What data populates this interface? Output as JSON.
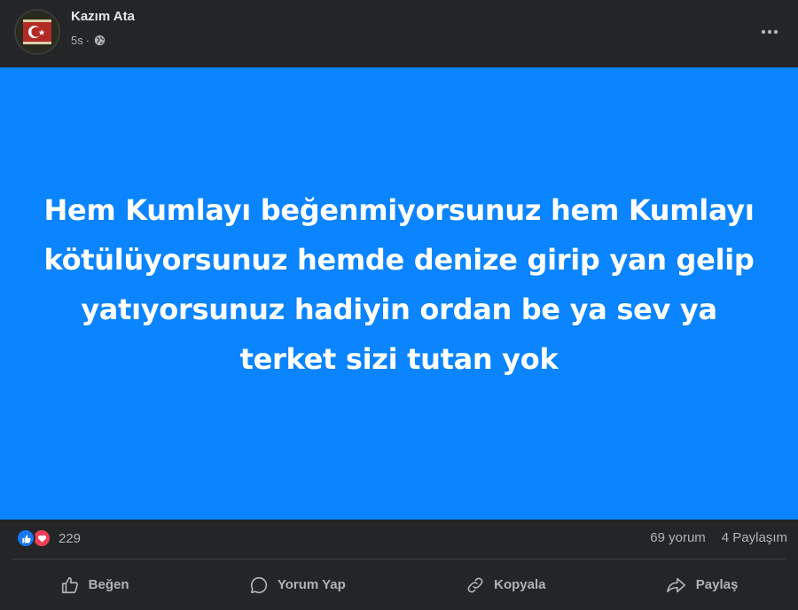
{
  "post": {
    "author": "Kazım Ata",
    "time": "5s",
    "separator": "·",
    "text": "Hem Kumlayı beğenmiyorsunuz hem Kumlayı kötülüyorsunuz hemde denize girip yan gelip yatıyorsunuz hadiyin ordan be ya sev ya terket sizi tutan yok",
    "background_color": "#0a84ff"
  },
  "stats": {
    "reaction_count": "229",
    "reactions": [
      "like-icon",
      "love-icon"
    ],
    "comments": "69 yorum",
    "shares": "4 Paylaşım"
  },
  "actions": {
    "like": "Beğen",
    "comment": "Yorum Yap",
    "copy": "Kopyala",
    "share": "Paylaş"
  },
  "colors": {
    "card": "#242526",
    "text_secondary": "#b0b3b8",
    "like_blue": "#1877f2",
    "love_red": "#f33e58"
  }
}
